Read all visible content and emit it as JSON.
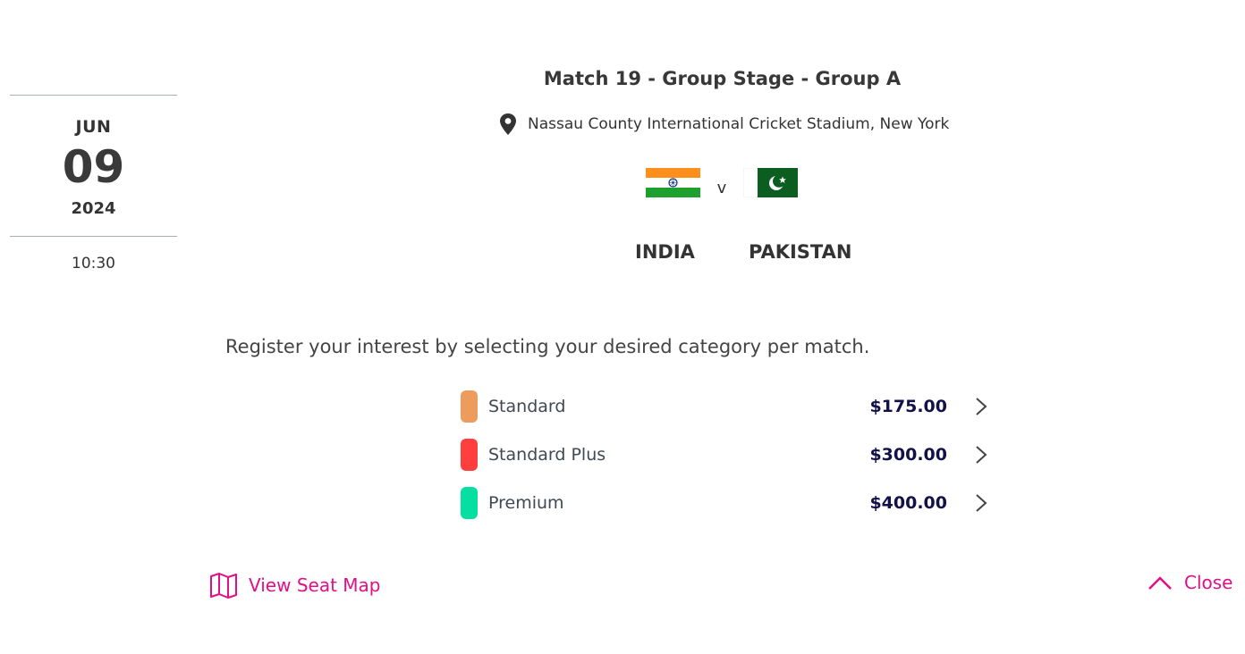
{
  "date": {
    "month": "JUN",
    "day": "09",
    "year": "2024",
    "time": "10:30"
  },
  "match": {
    "title": "Match 19 - Group Stage - Group A",
    "venue": "Nassau County International Cricket Stadium, New York",
    "vs": "v",
    "home_team": "INDIA",
    "away_team": "PAKISTAN",
    "home_flag_icon": "india-flag-icon",
    "away_flag_icon": "pakistan-flag-icon"
  },
  "register_text": "Register your interest by selecting your desired category per match.",
  "categories": [
    {
      "name": "Standard",
      "price": "$175.00",
      "color": "#EE9B5E"
    },
    {
      "name": "Standard Plus",
      "price": "$300.00",
      "color": "#FF3E3E"
    },
    {
      "name": "Premium",
      "price": "$400.00",
      "color": "#05DFA0"
    }
  ],
  "actions": {
    "seat_map_label": "View Seat Map",
    "close_label": "Close",
    "accent_color": "#E20F86"
  }
}
